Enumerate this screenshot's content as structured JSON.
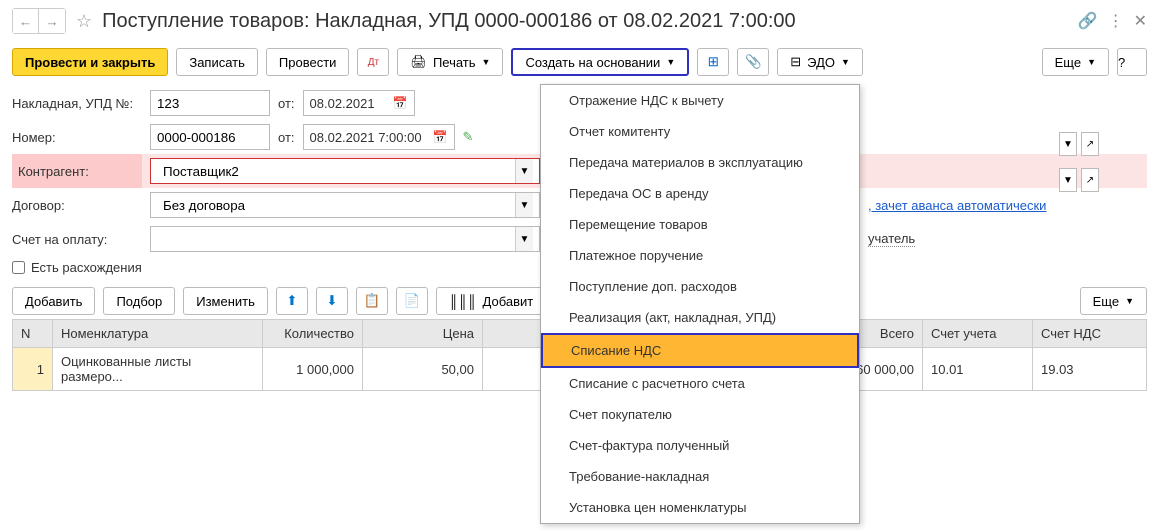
{
  "header": {
    "title": "Поступление товаров: Накладная, УПД 0000-000186 от 08.02.2021 7:00:00"
  },
  "toolbar": {
    "post_and_close": "Провести и закрыть",
    "save": "Записать",
    "post": "Провести",
    "print": "Печать",
    "create_based_on": "Создать на основании",
    "edo": "ЭДО",
    "more": "Еще",
    "help": "?"
  },
  "form": {
    "invoice_no_label": "Накладная, УПД №:",
    "invoice_no": "123",
    "from_label": "от:",
    "invoice_date": "08.02.2021",
    "number_label": "Номер:",
    "number": "0000-000186",
    "number_date": "08.02.2021 7:00:00",
    "contractor_label": "Контрагент:",
    "contractor": "Поставщик2",
    "contract_label": "Договор:",
    "contract": "Без договора",
    "contract_link": ", зачет аванса автоматически",
    "invoice_for_payment_label": "Счет на оплату:",
    "invoice_for_payment": "",
    "recipient_suffix": "учатель",
    "discrepancies_label": "Есть расхождения"
  },
  "table_toolbar": {
    "add": "Добавить",
    "pick": "Подбор",
    "edit": "Изменить",
    "add_barcode": "Добавит",
    "more": "Еще"
  },
  "table": {
    "headers": {
      "n": "N",
      "nomenclature": "Номенклатура",
      "qty": "Количество",
      "price": "Цена",
      "total": "Всего",
      "account": "Счет учета",
      "vat_account": "Счет НДС"
    },
    "rows": [
      {
        "n": "1",
        "nomenclature": "Оцинкованные листы размеро...",
        "qty": "1 000,000",
        "price": "50,00",
        "total": "60 000,00",
        "account": "10.01",
        "vat_account": "19.03"
      }
    ]
  },
  "menu": {
    "items": [
      "Отражение НДС к вычету",
      "Отчет комитенту",
      "Передача материалов в эксплуатацию",
      "Передача ОС в аренду",
      "Перемещение товаров",
      "Платежное поручение",
      "Поступление доп. расходов",
      "Реализация (акт, накладная, УПД)",
      "Списание НДС",
      "Списание с расчетного счета",
      "Счет покупателю",
      "Счет-фактура полученный",
      "Требование-накладная",
      "Установка цен номенклатуры"
    ],
    "highlight_index": 8
  }
}
